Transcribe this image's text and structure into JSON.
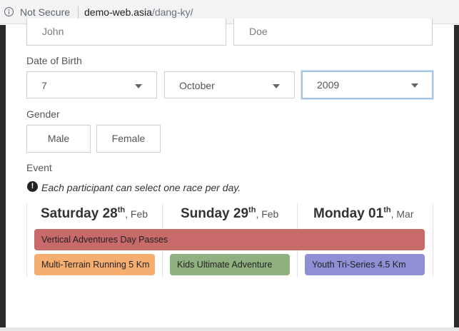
{
  "browser": {
    "security_label": "Not Secure",
    "url_host": "demo-web.asia",
    "url_path": "/dang-ky/"
  },
  "form": {
    "first_name": "John",
    "last_name": "Doe",
    "dob_label": "Date of Birth",
    "dob_day": "7",
    "dob_month": "October",
    "dob_year": "2009",
    "gender_label": "Gender",
    "gender_male": "Male",
    "gender_female": "Female",
    "event_label": "Event",
    "notice_icon": "!",
    "notice_text": "Each participant can select one race per day."
  },
  "calendar": {
    "days": [
      {
        "weekday": "Saturday 28",
        "suffix": "th",
        "month": ", Feb"
      },
      {
        "weekday": "Sunday 29",
        "suffix": "th",
        "month": ", Feb"
      },
      {
        "weekday": "Monday 01",
        "suffix": "th",
        "month": ", Mar"
      }
    ],
    "races": {
      "multi_day": "Vertical Adventures Day Passes",
      "day1": "Multi-Terrain Running 5 Km",
      "day2": "Kids Ultimate Adventure",
      "day3": "Youth Tri-Series 4.5 Km"
    }
  },
  "colors": {
    "multi_day": "#c86a6a",
    "day1": "#f6ad70",
    "day2": "#8fb07f",
    "day3": "#8f8fd6",
    "focus": "#a8c4e3"
  }
}
